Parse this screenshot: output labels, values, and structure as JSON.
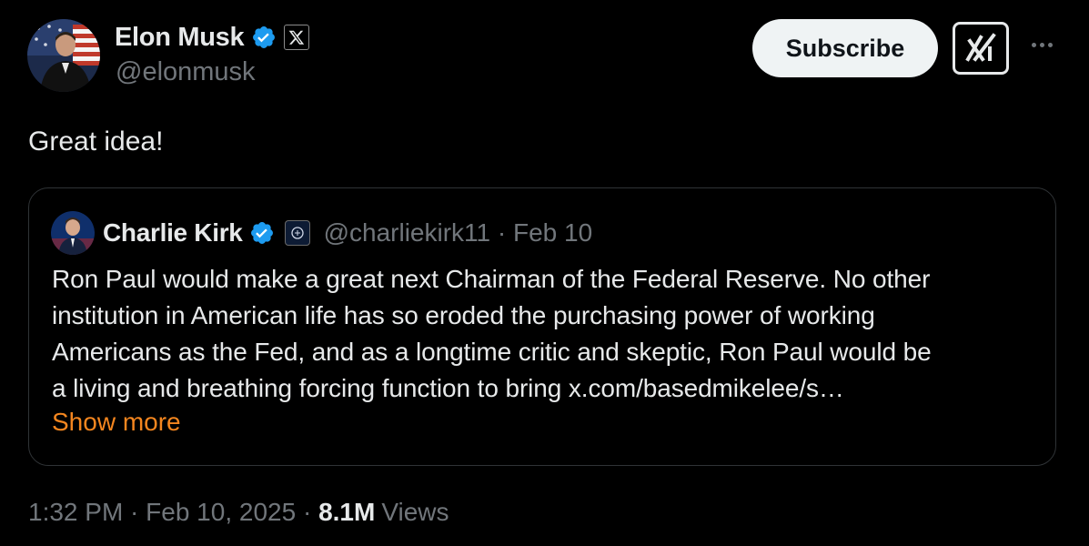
{
  "author": {
    "name": "Elon Musk",
    "handle": "@elonmusk",
    "verified": true,
    "affiliation_icon": "x-logo-icon"
  },
  "actions": {
    "subscribe_label": "Subscribe",
    "grok_icon": "grok-icon",
    "more_icon": "more-icon"
  },
  "tweet": {
    "text": "Great idea!"
  },
  "quoted_tweet": {
    "author_name": "Charlie Kirk",
    "handle_date": "@charliekirk11 · Feb 10",
    "verified": true,
    "affiliation_icon": "tpusa-badge-icon",
    "text": "Ron Paul would make a great next Chairman of the Federal Reserve. No other\ninstitution in American life has so eroded the purchasing power of working\nAmericans as the Fed, and as a longtime critic and skeptic, Ron Paul would be\na living and breathing forcing function to bring x.com/basedmikelee/s…",
    "show_more_label": "Show more"
  },
  "footer": {
    "timestamp": "1:32 PM · Feb 10, 2025 · ",
    "views_count": "8.1M",
    "views_label": "Views"
  },
  "colors": {
    "background": "#000000",
    "text": "#e7e9ea",
    "muted": "#71767b",
    "verified_blue": "#1d9bf0",
    "show_more": "#f4861f",
    "border": "#2f3336"
  }
}
